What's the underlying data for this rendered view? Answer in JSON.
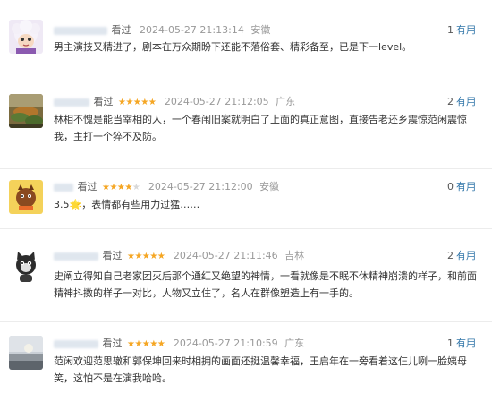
{
  "reviews": [
    {
      "watched": "看过",
      "rating_stars": 0,
      "time": "2024-05-27 21:13:14",
      "location": "安徽",
      "useful_count": "1",
      "useful_label": "有用",
      "content": "男主演技又精进了，剧本在万众期盼下还能不落俗套、精彩备至，已是下一level。"
    },
    {
      "watched": "看过",
      "rating_stars": 5,
      "time": "2024-05-27 21:12:05",
      "location": "广东",
      "useful_count": "2",
      "useful_label": "有用",
      "content": "林相不愧是能当宰相的人，一个春闱旧案就明白了上面的真正意图，直接告老还乡震惊范闲震惊我，主打一个猝不及防。"
    },
    {
      "watched": "看过",
      "rating_stars": 4,
      "time": "2024-05-27 21:12:00",
      "location": "安徽",
      "useful_count": "0",
      "useful_label": "有用",
      "content": "3.5🌟，表情都有些用力过猛……"
    },
    {
      "watched": "看过",
      "rating_stars": 5,
      "time": "2024-05-27 21:11:46",
      "location": "吉林",
      "useful_count": "2",
      "useful_label": "有用",
      "content": "史阐立得知自己老家团灭后那个通红又绝望的神情，一看就像是不眠不休精神崩溃的样子，和前面精神抖擞的样子一对比，人物又立住了，名人在群像塑造上有一手的。"
    },
    {
      "watched": "看过",
      "rating_stars": 5,
      "time": "2024-05-27 21:10:59",
      "location": "广东",
      "useful_count": "1",
      "useful_label": "有用",
      "content": "范闲欢迎范思辙和郭保坤回来时相拥的画面还挺温馨幸福，王启年在一旁看着这仨儿咧一脸姨母笑，这怕不是在演我哈哈。"
    }
  ],
  "colors": {
    "star": "#f5a623",
    "useful_link": "#3377aa",
    "meta": "#999999"
  }
}
